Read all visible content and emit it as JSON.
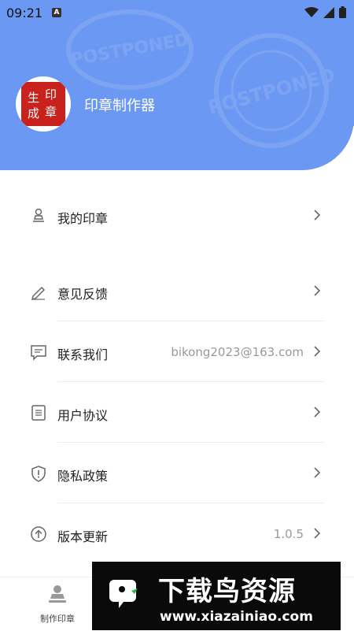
{
  "status_bar": {
    "time": "09:21",
    "notification_letter": "A"
  },
  "app": {
    "name": "印章制作器",
    "avatar_chars": [
      "生",
      "成",
      "印",
      "章"
    ]
  },
  "header_watermark": "POSTPONED",
  "menu": {
    "my_stamps": {
      "label": "我的印章"
    },
    "feedback": {
      "label": "意见反馈"
    },
    "contact": {
      "label": "联系我们",
      "value": "bikong2023@163.com"
    },
    "user_agreement": {
      "label": "用户协议"
    },
    "privacy": {
      "label": "隐私政策"
    },
    "version": {
      "label": "版本更新",
      "value": "1.0.5"
    }
  },
  "tabbar": {
    "make_stamp": "制作印章"
  },
  "banner": {
    "title": "下载鸟资源",
    "url": "www.xiazainiao.com"
  },
  "colors": {
    "header": "#6b98f2",
    "seal": "#c9221c"
  }
}
